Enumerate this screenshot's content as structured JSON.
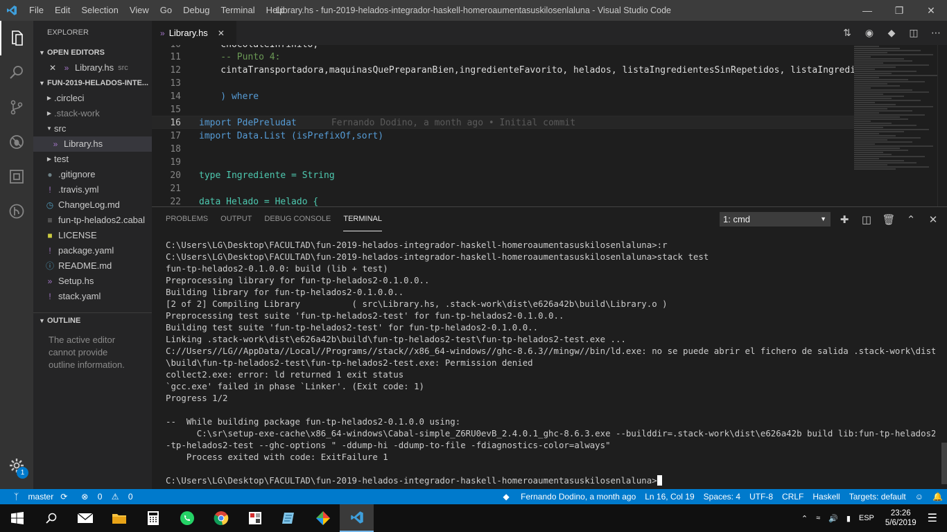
{
  "window": {
    "title": "Library.hs - fun-2019-helados-integrador-haskell-homeroaumentasuskilosenlaluna - Visual Studio Code",
    "menu": [
      "File",
      "Edit",
      "Selection",
      "View",
      "Go",
      "Debug",
      "Terminal",
      "Help"
    ]
  },
  "sidebar": {
    "header": "EXPLORER",
    "open_editors_label": "OPEN EDITORS",
    "open_editor": {
      "name": "Library.hs",
      "folder": "src"
    },
    "project_label": "FUN-2019-HELADOS-INTE...",
    "tree": [
      {
        "name": ".circleci",
        "kind": "folder",
        "icon": "chevron-right"
      },
      {
        "name": ".stack-work",
        "kind": "folder",
        "icon": "chevron-right"
      },
      {
        "name": "src",
        "kind": "folder-open",
        "icon": "chevron-down"
      },
      {
        "name": "Library.hs",
        "kind": "haskell-file",
        "icon": "haskell"
      },
      {
        "name": "test",
        "kind": "folder",
        "icon": "chevron-right"
      },
      {
        "name": ".gitignore",
        "kind": "file",
        "icon": "dot"
      },
      {
        "name": ".travis.yml",
        "kind": "yaml",
        "icon": "exclamation"
      },
      {
        "name": "ChangeLog.md",
        "kind": "markdown",
        "icon": "clock"
      },
      {
        "name": "fun-tp-helados2.cabal",
        "kind": "cabal",
        "icon": "lines"
      },
      {
        "name": "LICENSE",
        "kind": "license",
        "icon": "certificate"
      },
      {
        "name": "package.yaml",
        "kind": "yaml",
        "icon": "exclamation"
      },
      {
        "name": "README.md",
        "kind": "markdown",
        "icon": "info"
      },
      {
        "name": "Setup.hs",
        "kind": "haskell-file",
        "icon": "haskell"
      },
      {
        "name": "stack.yaml",
        "kind": "yaml",
        "icon": "exclamation"
      }
    ],
    "outline_label": "OUTLINE",
    "outline_empty": "The active editor cannot provide outline information."
  },
  "editor": {
    "tab_name": "Library.hs",
    "lines": [
      {
        "num": "10",
        "text": "    chocolateInfinito,"
      },
      {
        "num": "11",
        "text": "    -- Punto 4:"
      },
      {
        "num": "12",
        "text": "    cintaTransportadora,maquinasQuePreparanBien,ingredienteFavorito, helados, listaIngredientesSinRepetidos, listaIngredien"
      },
      {
        "num": "13",
        "text": ""
      },
      {
        "num": "14",
        "text": "    ) where"
      },
      {
        "num": "15",
        "text": ""
      },
      {
        "num": "16",
        "text": "import PdePreludat"
      },
      {
        "num": "17",
        "text": "import Data.List (isPrefixOf,sort)"
      },
      {
        "num": "18",
        "text": ""
      },
      {
        "num": "19",
        "text": ""
      },
      {
        "num": "20",
        "text": "type Ingrediente = String"
      },
      {
        "num": "21",
        "text": ""
      },
      {
        "num": "22",
        "text": "data Helado = Helado {"
      }
    ],
    "blame": "Fernando Dodino, a month ago • Initial commit"
  },
  "panel": {
    "tabs": [
      "PROBLEMS",
      "OUTPUT",
      "DEBUG CONSOLE",
      "TERMINAL"
    ],
    "active_tab": "TERMINAL",
    "terminal_select": "1: cmd",
    "terminal_lines": [
      "C:\\Users\\LG\\Desktop\\FACULTAD\\fun-2019-helados-integrador-haskell-homeroaumentasuskilosenlaluna>:r",
      "C:\\Users\\LG\\Desktop\\FACULTAD\\fun-2019-helados-integrador-haskell-homeroaumentasuskilosenlaluna>stack test",
      "fun-tp-helados2-0.1.0.0: build (lib + test)",
      "Preprocessing library for fun-tp-helados2-0.1.0.0..",
      "Building library for fun-tp-helados2-0.1.0.0..",
      "[2 of 2] Compiling Library          ( src\\Library.hs, .stack-work\\dist\\e626a42b\\build\\Library.o )",
      "Preprocessing test suite 'fun-tp-helados2-test' for fun-tp-helados2-0.1.0.0..",
      "Building test suite 'fun-tp-helados2-test' for fun-tp-helados2-0.1.0.0..",
      "Linking .stack-work\\dist\\e626a42b\\build\\fun-tp-helados2-test\\fun-tp-helados2-test.exe ...",
      "C://Users//LG//AppData//Local//Programs//stack//x86_64-windows//ghc-8.6.3//mingw//bin/ld.exe: no se puede abrir el fichero de salida .stack-work\\dist\\e626a42b",
      "\\build\\fun-tp-helados2-test\\fun-tp-helados2-test.exe: Permission denied",
      "collect2.exe: error: ld returned 1 exit status",
      "`gcc.exe' failed in phase `Linker'. (Exit code: 1)",
      "Progress 1/2",
      "",
      "--  While building package fun-tp-helados2-0.1.0.0 using:",
      "      C:\\sr\\setup-exe-cache\\x86_64-windows\\Cabal-simple_Z6RU0evB_2.4.0.1_ghc-8.6.3.exe --builddir=.stack-work\\dist\\e626a42b build lib:fun-tp-helados2 test:fun",
      "-tp-helados2-test --ghc-options \" -ddump-hi -ddump-to-file -fdiagnostics-color=always\"",
      "    Process exited with code: ExitFailure 1",
      "",
      "C:\\Users\\LG\\Desktop\\FACULTAD\\fun-2019-helados-integrador-haskell-homeroaumentasuskilosenlaluna>"
    ]
  },
  "statusbar": {
    "branch": "master",
    "errors": "0",
    "warnings": "0",
    "blame": "Fernando Dodino, a month ago",
    "position": "Ln 16, Col 19",
    "spaces": "Spaces: 4",
    "encoding": "UTF-8",
    "eol": "CRLF",
    "language": "Haskell",
    "targets": "Targets: default"
  },
  "activitybar": {
    "settings_badge": "1"
  },
  "taskbar": {
    "language": "ESP",
    "time": "23:26",
    "date": "5/6/2019"
  },
  "colors": {
    "accent": "#007acc",
    "haskell": "#a074c4",
    "yaml": "#a074c4",
    "keyword": "#569cd6",
    "type": "#4ec9b0",
    "comment": "#6a9955"
  }
}
